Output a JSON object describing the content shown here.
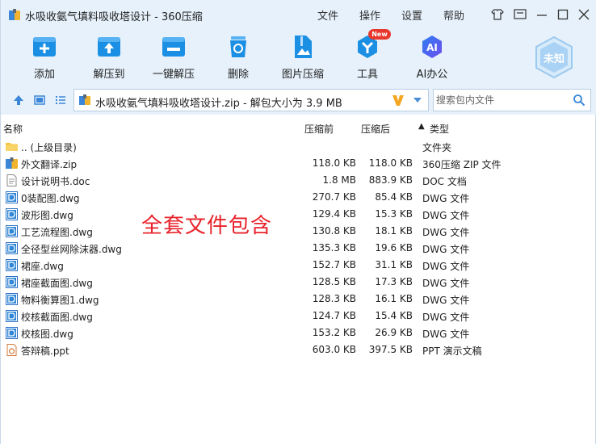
{
  "window": {
    "title": "水吸收氨气填料吸收塔设计 - 360压缩",
    "menu": [
      "文件",
      "操作",
      "设置",
      "帮助"
    ]
  },
  "toolbar": {
    "tools": [
      {
        "label": "添加",
        "icon": "add-file-icon"
      },
      {
        "label": "解压到",
        "icon": "extract-to-icon"
      },
      {
        "label": "一键解压",
        "icon": "one-click-extract-icon"
      },
      {
        "label": "删除",
        "icon": "recycle-bin-icon"
      },
      {
        "label": "图片压缩",
        "icon": "image-compress-icon"
      },
      {
        "label": "工具",
        "icon": "tools-icon"
      },
      {
        "label": "AI办公",
        "icon": "ai-office-icon"
      }
    ],
    "new_badge": "New",
    "brand_label": "未知"
  },
  "address": {
    "path_text": "水吸收氨气填料吸收塔设计.zip - 解包大小为 3.9 MB",
    "v_badge": "V",
    "search_placeholder": "搜索包内文件"
  },
  "list": {
    "columns": {
      "name": "名称",
      "before": "压缩前",
      "after": "压缩后",
      "type": "类型",
      "sort_indicator": "▲"
    },
    "rows": [
      {
        "name": ".. (上级目录)",
        "before": "",
        "after": "",
        "type": "文件夹",
        "icon": "folder-icon"
      },
      {
        "name": "外文翻译.zip",
        "before": "118.0 KB",
        "after": "118.0 KB",
        "type": "360压缩 ZIP 文件",
        "icon": "zip-file-icon"
      },
      {
        "name": "设计说明书.doc",
        "before": "1.8 MB",
        "after": "883.9 KB",
        "type": "DOC 文档",
        "icon": "doc-file-icon"
      },
      {
        "name": "0装配图.dwg",
        "before": "270.7 KB",
        "after": "85.4 KB",
        "type": "DWG 文件",
        "icon": "dwg-file-icon"
      },
      {
        "name": "波形图.dwg",
        "before": "129.4 KB",
        "after": "15.3 KB",
        "type": "DWG 文件",
        "icon": "dwg-file-icon"
      },
      {
        "name": "工艺流程图.dwg",
        "before": "130.8 KB",
        "after": "18.1 KB",
        "type": "DWG 文件",
        "icon": "dwg-file-icon"
      },
      {
        "name": "全径型丝网除沫器.dwg",
        "before": "135.3 KB",
        "after": "19.6 KB",
        "type": "DWG 文件",
        "icon": "dwg-file-icon"
      },
      {
        "name": "裙座.dwg",
        "before": "152.7 KB",
        "after": "31.1 KB",
        "type": "DWG 文件",
        "icon": "dwg-file-icon"
      },
      {
        "name": "裙座截面图.dwg",
        "before": "128.5 KB",
        "after": "17.3 KB",
        "type": "DWG 文件",
        "icon": "dwg-file-icon"
      },
      {
        "name": "物料衡算图1.dwg",
        "before": "128.3 KB",
        "after": "16.1 KB",
        "type": "DWG 文件",
        "icon": "dwg-file-icon"
      },
      {
        "name": "校核截面图.dwg",
        "before": "124.7 KB",
        "after": "15.4 KB",
        "type": "DWG 文件",
        "icon": "dwg-file-icon"
      },
      {
        "name": "校核图.dwg",
        "before": "153.2 KB",
        "after": "26.9 KB",
        "type": "DWG 文件",
        "icon": "dwg-file-icon"
      },
      {
        "name": "答辩稿.ppt",
        "before": "603.0 KB",
        "after": "397.5 KB",
        "type": "PPT 演示文稿",
        "icon": "ppt-file-icon"
      }
    ]
  },
  "overlay_text": "全套文件包含",
  "colors": {
    "accent": "#1a8fe3",
    "chrome": "#e6f1fb",
    "overlay": "#e8222a",
    "badge": "#e8372c"
  }
}
